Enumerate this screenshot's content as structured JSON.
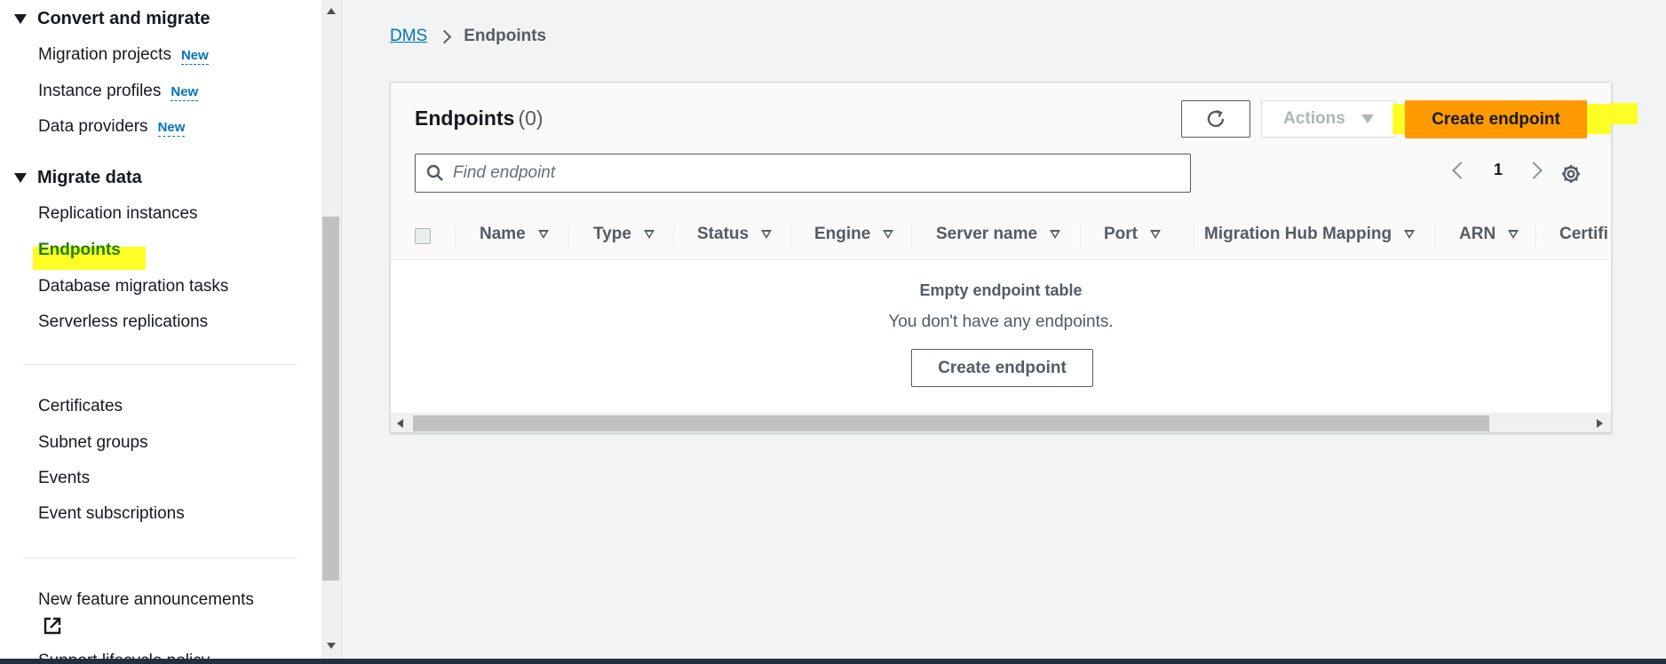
{
  "sidebar": {
    "sections": [
      {
        "label": "Convert and migrate"
      },
      {
        "label": "Migrate data"
      }
    ],
    "convert_items": [
      {
        "label": "Migration projects",
        "badge": "New"
      },
      {
        "label": "Instance profiles",
        "badge": "New"
      },
      {
        "label": "Data providers",
        "badge": "New"
      }
    ],
    "migrate_items": [
      {
        "label": "Replication instances"
      },
      {
        "label": "Endpoints"
      },
      {
        "label": "Database migration tasks"
      },
      {
        "label": "Serverless replications"
      }
    ],
    "other_items": [
      {
        "label": "Certificates"
      },
      {
        "label": "Subnet groups"
      },
      {
        "label": "Events"
      },
      {
        "label": "Event subscriptions"
      }
    ],
    "footer_items": [
      {
        "label": "New feature announcements"
      },
      {
        "label": "Support lifecycle policy"
      }
    ],
    "highlight_color": "#ffff00",
    "active_color": "#1d8102"
  },
  "breadcrumb": {
    "root": "DMS",
    "current": "Endpoints"
  },
  "panel": {
    "title": "Endpoints",
    "count": "(0)",
    "actions_label": "Actions",
    "create_label": "Create endpoint",
    "search_placeholder": "Find endpoint",
    "page": "1",
    "columns": [
      "Name",
      "Type",
      "Status",
      "Engine",
      "Server name",
      "Port",
      "Migration Hub Mapping",
      "ARN",
      "Certifi"
    ],
    "empty_title": "Empty endpoint table",
    "empty_message": "You don't have any endpoints.",
    "empty_button": "Create endpoint",
    "primary_color": "#ff9900",
    "link_color": "#0073bb"
  },
  "icons": {
    "refresh": "refresh-icon",
    "search": "search-icon",
    "settings": "gear-icon",
    "external": "external-link-icon"
  }
}
